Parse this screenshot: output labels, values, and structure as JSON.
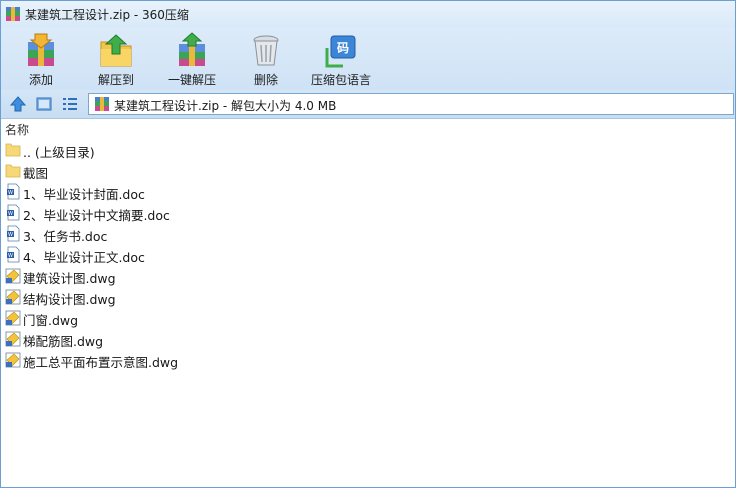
{
  "window": {
    "title": "某建筑工程设计.zip - 360压缩"
  },
  "toolbar": {
    "buttons": [
      {
        "label": "添加",
        "icon": "add-archive-icon"
      },
      {
        "label": "解压到",
        "icon": "extract-to-icon"
      },
      {
        "label": "一键解压",
        "icon": "one-click-extract-icon"
      },
      {
        "label": "删除",
        "icon": "trash-icon"
      },
      {
        "label": "压缩包语言",
        "icon": "archive-language-icon"
      }
    ]
  },
  "address": {
    "path": "某建筑工程设计.zip - 解包大小为 4.0 MB"
  },
  "list": {
    "column_name": "名称",
    "items": [
      {
        "name": ".. (上级目录)",
        "type": "folder"
      },
      {
        "name": "截图",
        "type": "folder"
      },
      {
        "name": "1、毕业设计封面.doc",
        "type": "doc"
      },
      {
        "name": "2、毕业设计中文摘要.doc",
        "type": "doc"
      },
      {
        "name": "3、任务书.doc",
        "type": "doc"
      },
      {
        "name": "4、毕业设计正文.doc",
        "type": "doc"
      },
      {
        "name": "建筑设计图.dwg",
        "type": "dwg"
      },
      {
        "name": "结构设计图.dwg",
        "type": "dwg"
      },
      {
        "name": "门窗.dwg",
        "type": "dwg"
      },
      {
        "name": "梯配筋图.dwg",
        "type": "dwg"
      },
      {
        "name": "施工总平面布置示意图.dwg",
        "type": "dwg"
      }
    ]
  },
  "colors": {
    "titlebar": "#e9f3fc",
    "toolbar": "#d4e6f7",
    "border": "#6b9fd4",
    "folder": "#f6d878"
  }
}
